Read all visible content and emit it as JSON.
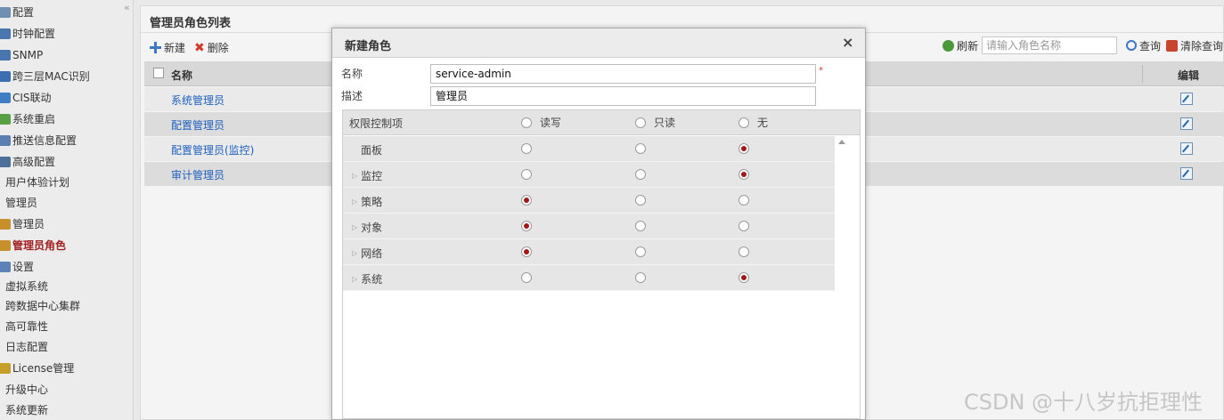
{
  "sidebar": {
    "collapse_symbol": "«",
    "items": [
      {
        "label": "配置",
        "icon": "folder-icon",
        "color": "#6f8fb3"
      },
      {
        "label": "时钟配置",
        "icon": "clock-icon",
        "color": "#4a76b0"
      },
      {
        "label": "SNMP",
        "icon": "network-icon",
        "color": "#4a76b0"
      },
      {
        "label": "跨三层MAC识别",
        "icon": "monitor-icon",
        "color": "#3a6fb2"
      },
      {
        "label": "CIS联动",
        "icon": "shield-icon",
        "color": "#3f7ec3"
      },
      {
        "label": "系统重启",
        "icon": "restart-icon",
        "color": "#58a044"
      },
      {
        "label": "推送信息配置",
        "icon": "message-icon",
        "color": "#5a7fb0"
      },
      {
        "label": "高级配置",
        "icon": "gear-icon",
        "color": "#4d6f9a"
      },
      {
        "label": "用户体验计划",
        "icon": "",
        "color": ""
      },
      {
        "label": "管理员",
        "icon": "",
        "color": ""
      },
      {
        "label": "管理员",
        "icon": "user-icon",
        "color": "#c7902c"
      },
      {
        "label": "管理员角色",
        "icon": "role-icon",
        "color": "#c7902c"
      },
      {
        "label": "设置",
        "icon": "settings-icon",
        "color": "#5c82b8"
      },
      {
        "label": "虚拟系统",
        "icon": "",
        "color": ""
      },
      {
        "label": "跨数据中心集群",
        "icon": "",
        "color": ""
      },
      {
        "label": "高可靠性",
        "icon": "",
        "color": ""
      },
      {
        "label": "日志配置",
        "icon": "",
        "color": ""
      },
      {
        "label": "License管理",
        "icon": "license-icon",
        "color": "#c7a02c"
      },
      {
        "label": "升级中心",
        "icon": "",
        "color": ""
      },
      {
        "label": "系统更新",
        "icon": "",
        "color": ""
      }
    ]
  },
  "panel": {
    "title": "管理员角色列表",
    "new_label": "新建",
    "delete_label": "删除",
    "refresh_label": "刷新",
    "search_placeholder": "请输入角色名称",
    "query_label": "查询",
    "clear_label": "清除查询"
  },
  "grid": {
    "headers": {
      "name": "名称",
      "edit": "编辑"
    },
    "rows": [
      "系统管理员",
      "配置管理员",
      "配置管理员(监控)",
      "审计管理员"
    ]
  },
  "dialog": {
    "title": "新建角色",
    "close_symbol": "×",
    "name_label": "名称",
    "name_value": "service-admin",
    "required_mark": "*",
    "desc_label": "描述",
    "desc_value": "管理员",
    "perm": {
      "header_label": "权限控制项",
      "options": [
        "读写",
        "只读",
        "无"
      ],
      "rows": [
        {
          "name": "面板",
          "expandable": false,
          "selected": 2
        },
        {
          "name": "监控",
          "expandable": true,
          "selected": 2
        },
        {
          "name": "策略",
          "expandable": true,
          "selected": 0
        },
        {
          "name": "对象",
          "expandable": true,
          "selected": 0
        },
        {
          "name": "网络",
          "expandable": true,
          "selected": 0
        },
        {
          "name": "系统",
          "expandable": true,
          "selected": 2
        }
      ]
    }
  },
  "watermark": "CSDN @十八岁抗拒理性"
}
